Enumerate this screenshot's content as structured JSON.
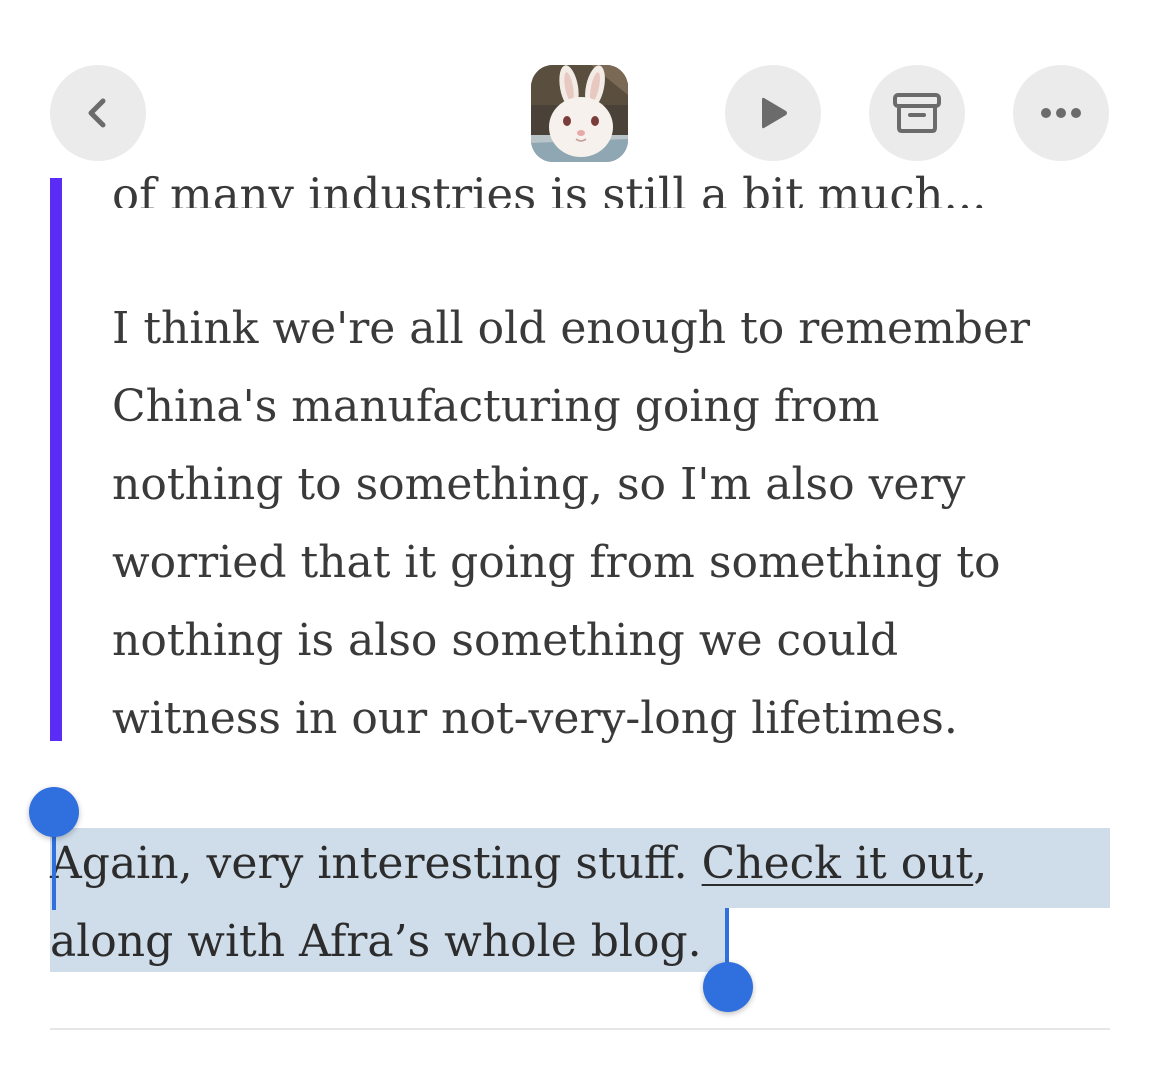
{
  "toolbar": {
    "back_icon": "chevron-left-icon",
    "avatar_icon": "rabbit-avatar",
    "play_icon": "play-icon",
    "archive_icon": "archive-icon",
    "more_icon": "ellipsis-icon"
  },
  "quote": {
    "cutoff_line": "of many industries is still a bit much...",
    "lines": [
      "I think we're all old enough to remember",
      "China's manufacturing going from",
      "nothing to something, so I'm also very",
      "worried that it going from something to",
      "nothing is also something we could",
      "witness in our not-very-long lifetimes."
    ],
    "accent_color": "#5b2cf5"
  },
  "paragraph": {
    "line1_prefix": "Again, very interesting stuff. ",
    "link_text": "Check it out",
    "line1_suffix": ",",
    "line2": "along with Afra’s whole blog."
  },
  "selection": {
    "highlight_color": "#cfdcea",
    "handle_color": "#2f6fde"
  }
}
